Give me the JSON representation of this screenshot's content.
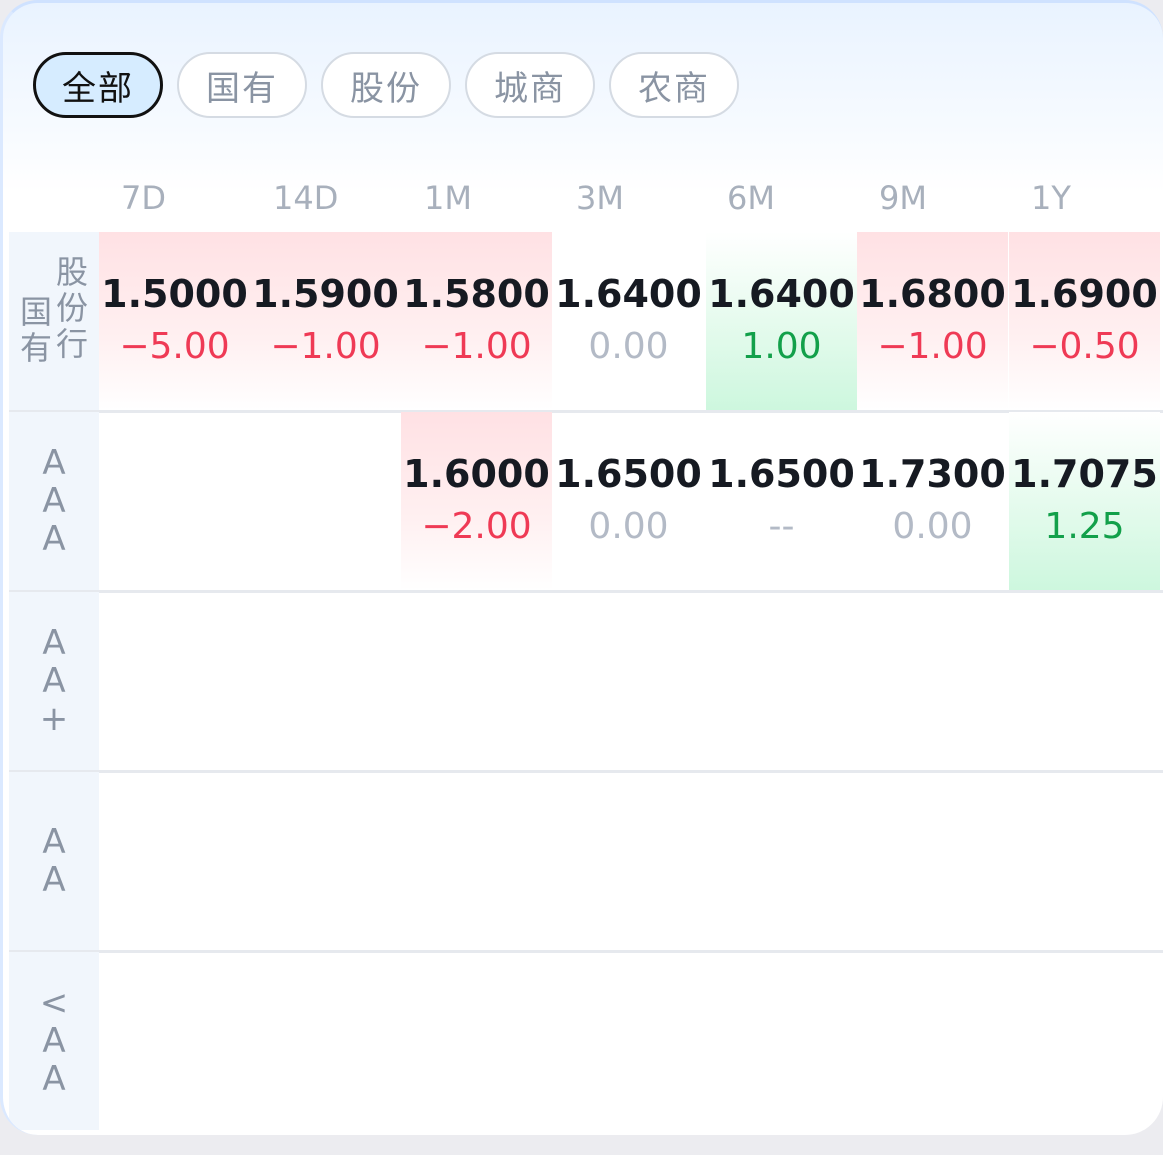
{
  "tabs": [
    {
      "label": "全部"
    },
    {
      "label": "国有"
    },
    {
      "label": "股份"
    },
    {
      "label": "城商"
    },
    {
      "label": "农商"
    }
  ],
  "columns": [
    "7D",
    "14D",
    "1M",
    "3M",
    "6M",
    "9M",
    "1Y"
  ],
  "rows": [
    {
      "label_left": "国有",
      "label_right": "股份行",
      "cells": [
        {
          "value": "1.5000",
          "change": "−5.00",
          "tone": "red"
        },
        {
          "value": "1.5900",
          "change": "−1.00",
          "tone": "red"
        },
        {
          "value": "1.5800",
          "change": "−1.00",
          "tone": "red"
        },
        {
          "value": "1.6400",
          "change": "0.00",
          "tone": "none"
        },
        {
          "value": "1.6400",
          "change": "1.00",
          "tone": "green"
        },
        {
          "value": "1.6800",
          "change": "−1.00",
          "tone": "red"
        },
        {
          "value": "1.6900",
          "change": "−0.50",
          "tone": "red"
        }
      ]
    },
    {
      "label": "AAA",
      "cells": [
        {
          "value": "",
          "change": "",
          "tone": "none"
        },
        {
          "value": "",
          "change": "",
          "tone": "none"
        },
        {
          "value": "1.6000",
          "change": "−2.00",
          "tone": "red"
        },
        {
          "value": "1.6500",
          "change": "0.00",
          "tone": "none"
        },
        {
          "value": "1.6500",
          "change": "--",
          "tone": "none"
        },
        {
          "value": "1.7300",
          "change": "0.00",
          "tone": "none"
        },
        {
          "value": "1.7075",
          "change": "1.25",
          "tone": "green"
        }
      ]
    },
    {
      "label": "AA+",
      "cells": []
    },
    {
      "label": "AA",
      "cells": []
    },
    {
      "label": "<AA",
      "cells": []
    }
  ],
  "colors": {
    "negative": "#ef3a55",
    "positive": "#12a04a",
    "neutral": "#b3bac6",
    "active_tab_bg": "#d6ecff"
  }
}
